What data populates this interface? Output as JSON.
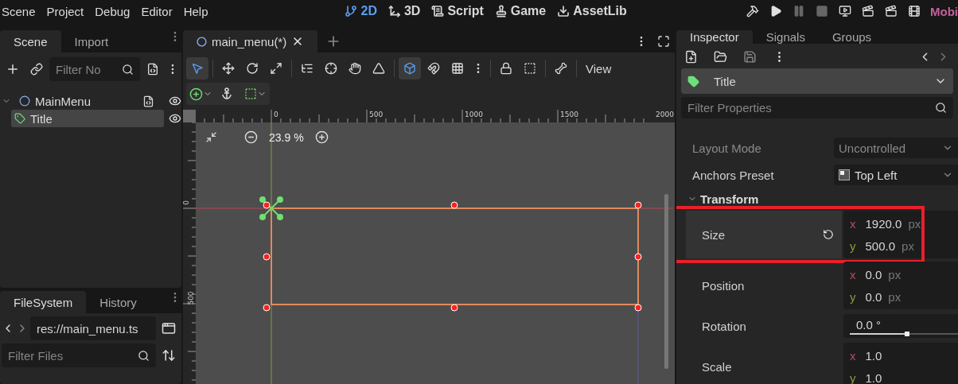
{
  "menu_bar": {
    "menus": [
      "Scene",
      "Project",
      "Debug",
      "Editor",
      "Help"
    ],
    "workspaces": [
      {
        "kind": "canvas",
        "label": "2D",
        "selected": true
      },
      {
        "kind": "spatial",
        "label": "3D",
        "selected": false
      },
      {
        "kind": "script",
        "label": "Script",
        "selected": false
      },
      {
        "kind": "game",
        "label": "Game",
        "selected": false
      },
      {
        "kind": "assetlib",
        "label": "AssetLib",
        "selected": false
      }
    ],
    "run_buttons": [
      {
        "kind": "build",
        "disabled": false
      },
      {
        "kind": "play",
        "disabled": false
      },
      {
        "kind": "pause",
        "disabled": true
      },
      {
        "kind": "stop",
        "disabled": true
      },
      {
        "kind": "remote",
        "disabled": false
      },
      {
        "kind": "play-scene",
        "disabled": false
      },
      {
        "kind": "play-custom",
        "disabled": false
      },
      {
        "kind": "movie",
        "disabled": false
      }
    ],
    "renderer": "Mobi"
  },
  "scene_dock": {
    "tabs": [
      {
        "label": "Scene",
        "selected": true
      },
      {
        "label": "Import",
        "selected": false
      }
    ],
    "filter": {
      "placeholder": "Filter No"
    },
    "tree": [
      {
        "name": "MainMenu",
        "kind": "control",
        "selected": false,
        "has_script": true,
        "visible": true,
        "expanded": true,
        "children": [
          {
            "name": "Title",
            "kind": "label",
            "selected": true,
            "visible": true
          }
        ]
      }
    ]
  },
  "filesystem_dock": {
    "tabs": [
      {
        "label": "FileSystem",
        "selected": true
      },
      {
        "label": "History",
        "selected": false
      }
    ],
    "path": "res://main_menu.ts",
    "filter": {
      "placeholder": "Filter Files"
    }
  },
  "editor": {
    "tabs": [
      {
        "label": "main_menu(*)",
        "selected": true
      }
    ],
    "tools": [
      {
        "kind": "select",
        "selected": true
      },
      {
        "kind": "sep"
      },
      {
        "kind": "move",
        "selected": false
      },
      {
        "kind": "rotate",
        "selected": false
      },
      {
        "kind": "scale",
        "selected": false
      },
      {
        "kind": "sep"
      },
      {
        "kind": "list",
        "selected": false
      },
      {
        "kind": "pivot",
        "selected": false
      },
      {
        "kind": "pan",
        "selected": false
      },
      {
        "kind": "ruler",
        "selected": false
      },
      {
        "kind": "sep"
      },
      {
        "kind": "snap",
        "selected": true
      },
      {
        "kind": "smart",
        "selected": false
      },
      {
        "kind": "grid",
        "selected": false
      },
      {
        "kind": "more",
        "selected": false
      },
      {
        "kind": "sep"
      },
      {
        "kind": "lock",
        "selected": false
      },
      {
        "kind": "group",
        "selected": false
      },
      {
        "kind": "sep"
      },
      {
        "kind": "bone",
        "selected": false
      },
      {
        "kind": "sep"
      }
    ],
    "view_menu": "View",
    "zoom": "23.9 %",
    "ruler": {
      "horizontal": [
        "0",
        "500",
        "1000",
        "1500",
        "2000"
      ],
      "vertical": [
        "0",
        "500"
      ]
    }
  },
  "inspector": {
    "tabs": [
      {
        "label": "Inspector",
        "selected": true
      },
      {
        "label": "Signals",
        "selected": false
      },
      {
        "label": "Groups",
        "selected": false
      }
    ],
    "node": "Title",
    "filter": {
      "placeholder": "Filter Properties"
    },
    "properties": [
      {
        "kind": "dropdown",
        "label": "Layout Mode",
        "value": "Uncontrolled",
        "disabled": true
      },
      {
        "kind": "dropdown",
        "label": "Anchors Preset",
        "value": "Top Left",
        "disabled": false
      },
      {
        "kind": "section",
        "label": "Transform",
        "expanded": true
      },
      {
        "kind": "vector",
        "label": "Size",
        "highlighted": true,
        "revertable": true,
        "components": [
          {
            "axis": "x",
            "value": "1920.0",
            "unit": "px"
          },
          {
            "axis": "y",
            "value": "500.0",
            "unit": "px"
          }
        ]
      },
      {
        "kind": "vector",
        "label": "Position",
        "components": [
          {
            "axis": "x",
            "value": "0.0",
            "unit": "px"
          },
          {
            "axis": "y",
            "value": "0.0",
            "unit": "px"
          }
        ]
      },
      {
        "kind": "slider",
        "label": "Rotation",
        "value": "0.0 °",
        "level": 0.53
      },
      {
        "kind": "vector",
        "label": "Scale",
        "components": [
          {
            "axis": "x",
            "value": "1.0"
          },
          {
            "axis": "y",
            "value": "1.0"
          }
        ]
      }
    ]
  }
}
